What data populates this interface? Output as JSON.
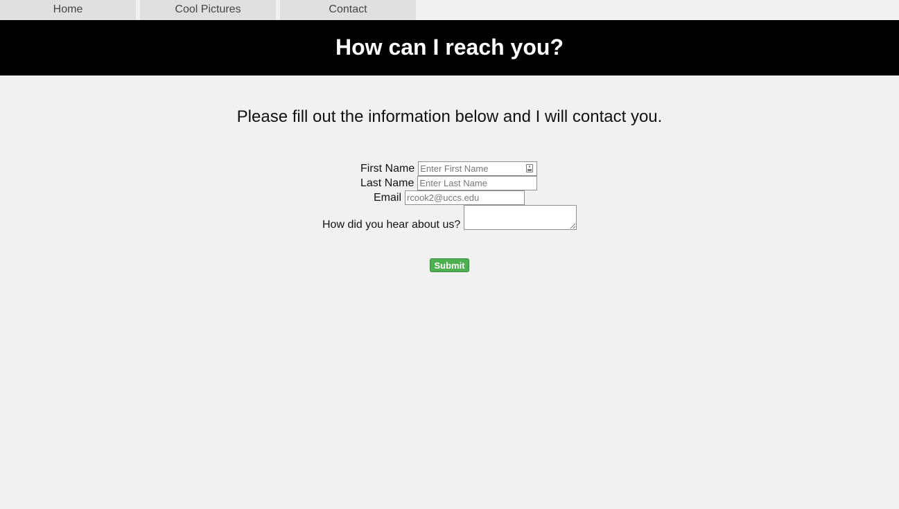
{
  "nav": {
    "items": [
      {
        "label": "Home"
      },
      {
        "label": "Cool Pictures"
      },
      {
        "label": "Contact"
      }
    ]
  },
  "banner": {
    "title": "How can I reach you?"
  },
  "intro": {
    "text": "Please fill out the information below and I will contact you."
  },
  "form": {
    "first_name": {
      "label": "First Name",
      "placeholder": "Enter First Name",
      "value": ""
    },
    "last_name": {
      "label": "Last Name",
      "placeholder": "Enter Last Name",
      "value": ""
    },
    "email": {
      "label": "Email",
      "placeholder": "rcook2@uccs.edu",
      "value": ""
    },
    "referral": {
      "label": "How did you hear about us?",
      "value": ""
    },
    "submit_label": "Submit"
  },
  "colors": {
    "banner_bg": "#000000",
    "page_bg": "#f1f1f1",
    "nav_bg": "#e0e0e0",
    "submit_bg": "#4caf50"
  }
}
